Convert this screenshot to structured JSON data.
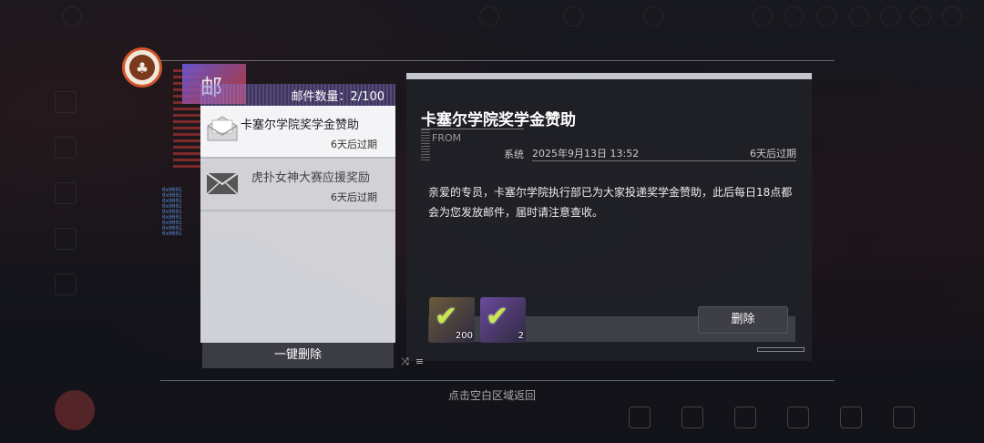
{
  "mail_header": {
    "title": "邮件",
    "count_text": "邮件数量：2/100"
  },
  "mails": [
    {
      "subject": "卡塞尔学院奖学金赞助",
      "expire": "6天后过期",
      "selected": true
    },
    {
      "subject": "虎扑女神大赛应援奖励",
      "expire": "6天后过期",
      "selected": false
    }
  ],
  "delete_all_label": "一键删除",
  "detail": {
    "title": "卡塞尔学院奖学金赞助",
    "from_label": "FROM",
    "sender": "系统",
    "date": "2025年9月13日 13:52",
    "expire": "6天后过期",
    "body": "亲爱的专员，卡塞尔学院执行部已为大家投递奖学金赞助，此后每日18点都会为您发放邮件，届时请注意查收。",
    "attachments": [
      {
        "qty": "200",
        "color": "#3a2e58"
      },
      {
        "qty": "2",
        "color": "#4a2a6a"
      }
    ],
    "delete_label": "删除"
  },
  "hint": "点击空白区域返回",
  "colors": {
    "accent_check": "#c8e84a",
    "emblem_ring": "#d2562c"
  }
}
